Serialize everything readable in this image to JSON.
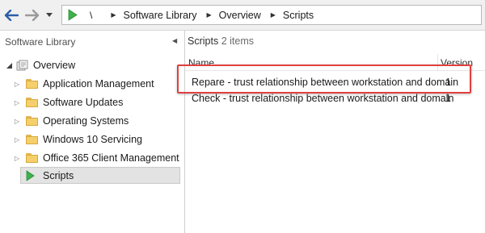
{
  "breadcrumb": {
    "root": "\\",
    "items": [
      "Software Library",
      "Overview",
      "Scripts"
    ]
  },
  "left_pane": {
    "title": "Software Library",
    "overview_label": "Overview",
    "items": [
      {
        "label": "Application Management",
        "icon": "folder-icon"
      },
      {
        "label": "Software Updates",
        "icon": "folder-icon"
      },
      {
        "label": "Operating Systems",
        "icon": "folder-icon"
      },
      {
        "label": "Windows 10 Servicing",
        "icon": "folder-icon"
      },
      {
        "label": "Office 365 Client Management",
        "icon": "folder-icon"
      },
      {
        "label": "Scripts",
        "icon": "scripts-icon",
        "selected": true
      }
    ]
  },
  "right_pane": {
    "title": "Scripts",
    "count": "2 items",
    "columns": [
      "Name",
      "Version"
    ],
    "rows": [
      {
        "name": "Repare - trust relationship between workstation and domain",
        "version": "1"
      },
      {
        "name": "Check - trust relationship between workstation and domain",
        "version": "1"
      }
    ]
  },
  "colors": {
    "accent_green": "#3cb24a",
    "highlight_red": "#e0403f",
    "folder_yellow": "#f5cf6b"
  }
}
